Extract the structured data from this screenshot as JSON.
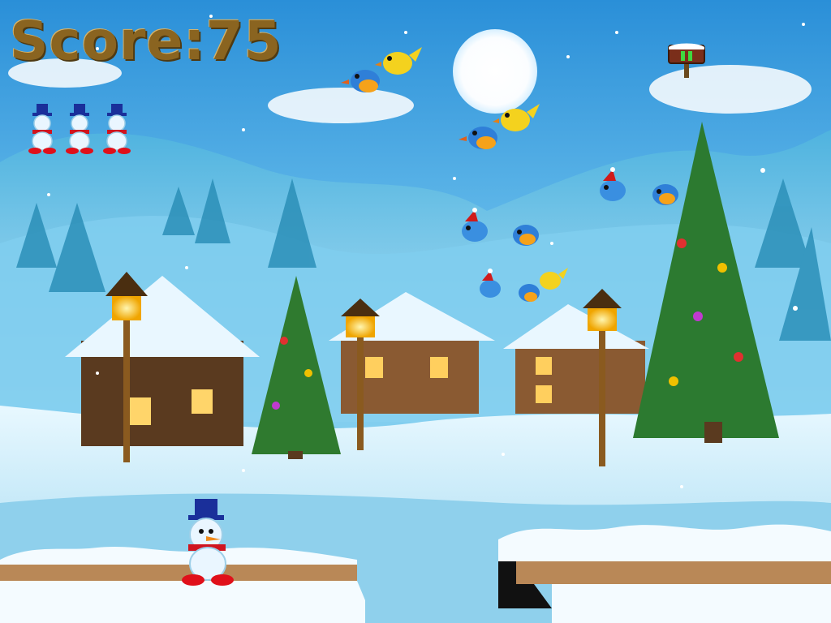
{
  "hud": {
    "score_label": "Score:",
    "score_value": "75",
    "lives_remaining": 3,
    "pause_icon": "pause-icon"
  },
  "scene": {
    "setting": "winter-village",
    "colors": {
      "sky_top": "#2a8fd8",
      "sky_bottom": "#bfe9fb",
      "snow": "#f4fbff",
      "ice": "#8fd0ec",
      "wood": "#b98857",
      "tree": "#2f7a2f",
      "score_gold": "#8a6420"
    },
    "objects": [
      {
        "type": "lamp-post"
      },
      {
        "type": "lamp-post"
      },
      {
        "type": "lamp-post"
      },
      {
        "type": "christmas-tree"
      },
      {
        "type": "christmas-tree"
      },
      {
        "type": "cabin"
      },
      {
        "type": "cabin"
      },
      {
        "type": "cabin"
      }
    ],
    "birds": [
      {
        "kind": "blue"
      },
      {
        "kind": "yellow"
      },
      {
        "kind": "blue"
      },
      {
        "kind": "yellow"
      },
      {
        "kind": "blue-santa-hat"
      },
      {
        "kind": "blue"
      },
      {
        "kind": "blue-santa-hat"
      },
      {
        "kind": "blue"
      },
      {
        "kind": "blue-santa-hat"
      },
      {
        "kind": "blue"
      },
      {
        "kind": "yellow"
      }
    ],
    "player": {
      "character": "snowman-top-hat"
    }
  }
}
